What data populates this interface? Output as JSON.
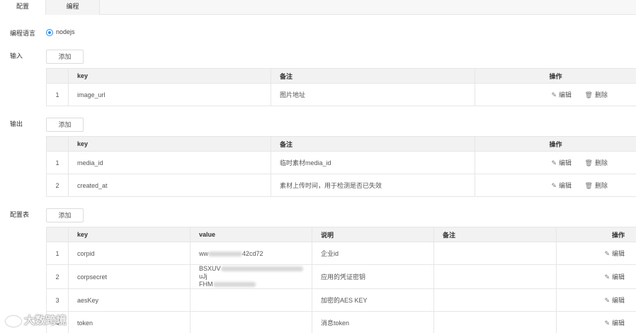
{
  "tabs": [
    {
      "label": "配置",
      "active": true
    },
    {
      "label": "编程",
      "active": false
    }
  ],
  "language": {
    "label": "编程语言",
    "option": "nodejs",
    "selected": true
  },
  "input": {
    "label": "输入",
    "add_label": "添加",
    "headers": [
      "",
      "key",
      "备注",
      "操作"
    ],
    "rows": [
      {
        "no": "1",
        "key": "image_url",
        "note": "图片地址"
      }
    ]
  },
  "output": {
    "label": "输出",
    "add_label": "添加",
    "headers": [
      "",
      "key",
      "备注",
      "操作"
    ],
    "rows": [
      {
        "no": "1",
        "key": "media_id",
        "note": "临时素材media_id"
      },
      {
        "no": "2",
        "key": "created_at",
        "note": "素材上传时间，用于检测是否已失效"
      }
    ]
  },
  "config": {
    "label": "配置表",
    "add_label": "添加",
    "headers": [
      "",
      "key",
      "value",
      "说明",
      "备注",
      "操作"
    ],
    "rows": [
      {
        "no": "1",
        "key": "corpid",
        "value_a": "ww",
        "value_b": "42cd72",
        "desc": "企业id",
        "note": ""
      },
      {
        "no": "2",
        "key": "corpsecret",
        "value_a": "BSXUV",
        "value_b": "uJj",
        "value_c": "FHM",
        "desc": "应用的凭证密钥",
        "note": ""
      },
      {
        "no": "3",
        "key": "aesKey",
        "value_a": "",
        "desc": "加密的AES KEY",
        "note": ""
      },
      {
        "no": "4",
        "key": "token",
        "value_a": "",
        "desc": "消息token",
        "note": ""
      }
    ]
  },
  "actions": {
    "edit": "编辑",
    "delete": "删除"
  },
  "icons": {
    "edit": "pencil-icon",
    "delete": "trash-icon"
  },
  "watermark": "大数跨境",
  "colors": {
    "accent": "#1e90ff",
    "header_bg": "#f2f2f2",
    "border": "#e6e6e6"
  }
}
